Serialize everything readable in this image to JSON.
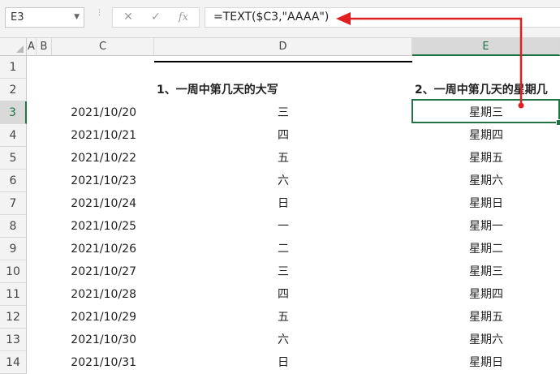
{
  "formula_bar": {
    "name_box": "E3",
    "cancel_icon": "✕",
    "enter_icon": "✓",
    "fx_label": "fx",
    "formula": "=TEXT($C3,\"AAAA\")"
  },
  "columns": [
    {
      "id": "A",
      "label": "A"
    },
    {
      "id": "B",
      "label": "B"
    },
    {
      "id": "C",
      "label": "C"
    },
    {
      "id": "D",
      "label": "D"
    },
    {
      "id": "E",
      "label": "E"
    }
  ],
  "selected_cell": "E3",
  "header_row": {
    "row": 2,
    "D": "1、一周中第几天的大写",
    "E": "2、一周中第几天的星期几"
  },
  "rows": [
    {
      "row": "1",
      "C": "",
      "D": "",
      "E": ""
    },
    {
      "row": "2",
      "C": "",
      "D": "",
      "E": ""
    },
    {
      "row": "3",
      "C": "2021/10/20",
      "D": "三",
      "E": "星期三"
    },
    {
      "row": "4",
      "C": "2021/10/21",
      "D": "四",
      "E": "星期四"
    },
    {
      "row": "5",
      "C": "2021/10/22",
      "D": "五",
      "E": "星期五"
    },
    {
      "row": "6",
      "C": "2021/10/23",
      "D": "六",
      "E": "星期六"
    },
    {
      "row": "7",
      "C": "2021/10/24",
      "D": "日",
      "E": "星期日"
    },
    {
      "row": "8",
      "C": "2021/10/25",
      "D": "一",
      "E": "星期一"
    },
    {
      "row": "9",
      "C": "2021/10/26",
      "D": "二",
      "E": "星期二"
    },
    {
      "row": "10",
      "C": "2021/10/27",
      "D": "三",
      "E": "星期三"
    },
    {
      "row": "11",
      "C": "2021/10/28",
      "D": "四",
      "E": "星期四"
    },
    {
      "row": "12",
      "C": "2021/10/29",
      "D": "五",
      "E": "星期五"
    },
    {
      "row": "13",
      "C": "2021/10/30",
      "D": "六",
      "E": "星期六"
    },
    {
      "row": "14",
      "C": "2021/10/31",
      "D": "日",
      "E": "星期日"
    }
  ],
  "annotation": {
    "arrow_color": "#e02020",
    "accent": "#217346"
  }
}
